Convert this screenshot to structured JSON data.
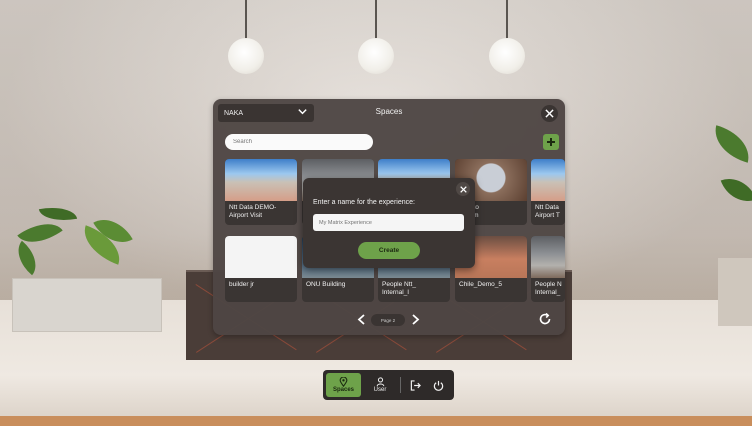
{
  "space_panel": {
    "organization": "NAKA",
    "title": "Spaces",
    "search_placeholder": "Search",
    "cards": [
      {
        "label": "Ntt Data DEMO-\nAirport Visit",
        "thumb": "t-sky"
      },
      {
        "label": "",
        "thumb": "t-hall"
      },
      {
        "label": "",
        "thumb": "t-sky"
      },
      {
        "label": "O Auto\nwroom",
        "thumb": "t-car"
      },
      {
        "label": "Ntt Data\nAirport T",
        "thumb": "t-sky"
      },
      {
        "label": "builder jr",
        "thumb": "t-white"
      },
      {
        "label": "ONU Building",
        "thumb": "t-blue"
      },
      {
        "label": "People Ntt_\nInternal_I",
        "thumb": "t-blue"
      },
      {
        "label": "Chile_Demo_5",
        "thumb": "t-room"
      },
      {
        "label": "People N\nInternal_",
        "thumb": "t-hall"
      }
    ],
    "pager": {
      "label": "Page 2"
    }
  },
  "modal": {
    "title": "Enter a name for the experience:",
    "input_placeholder": "My Matrix Experience",
    "create_label": "Create"
  },
  "dock": {
    "spaces_label": "Spaces",
    "user_label": "User"
  },
  "colors": {
    "accent": "#6ea24a",
    "panel_bg": "#4e4644",
    "modal_bg": "#3b3533"
  }
}
